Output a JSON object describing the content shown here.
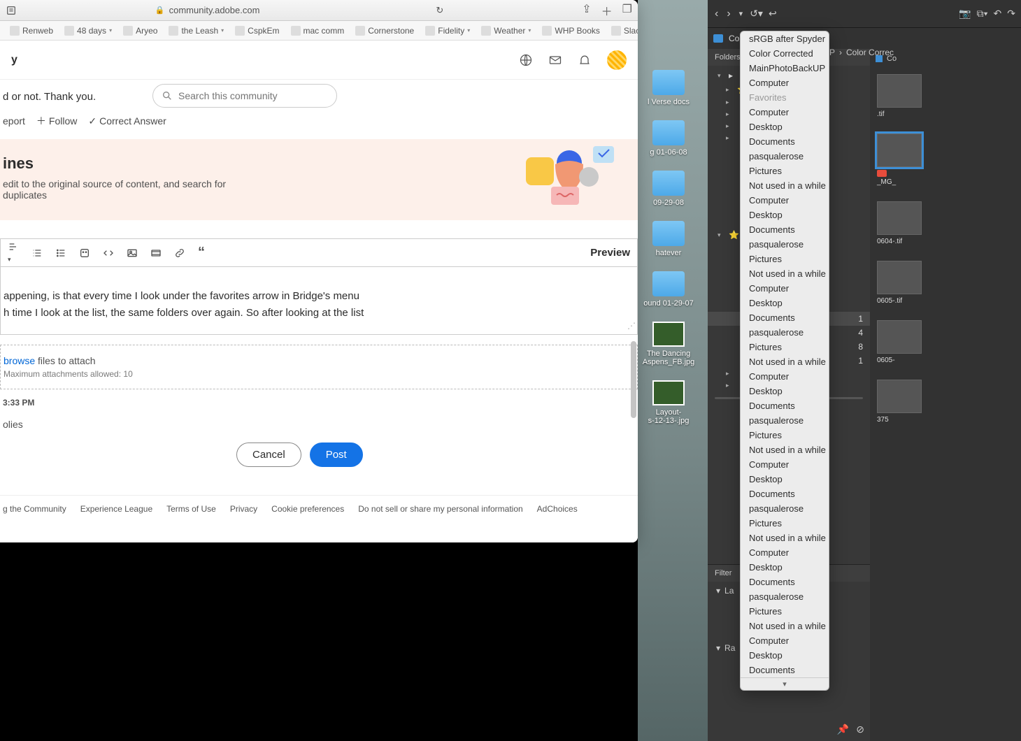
{
  "safari": {
    "url_host": "community.adobe.com",
    "bookmarks": [
      {
        "label": "Renweb",
        "caret": false
      },
      {
        "label": "48 days",
        "caret": true
      },
      {
        "label": "Aryeo",
        "caret": false
      },
      {
        "label": "the Leash",
        "caret": true
      },
      {
        "label": "CspkEm",
        "caret": false
      },
      {
        "label": "mac comm",
        "caret": false
      },
      {
        "label": "Cornerstone",
        "caret": false
      },
      {
        "label": "Fidelity",
        "caret": true
      },
      {
        "label": "Weather",
        "caret": true
      },
      {
        "label": "WHP Books",
        "caret": false
      },
      {
        "label": "Slack",
        "caret": false
      }
    ]
  },
  "community": {
    "title_fragment": "y",
    "search_placeholder": "Search this community",
    "line1": "d or not. Thank you.",
    "actions": {
      "report": "eport",
      "follow": "Follow",
      "correct": "Correct Answer"
    },
    "banner": {
      "title": "ines",
      "sub": "edit to the original source of content, and search for duplicates"
    },
    "editor": {
      "preview": "Preview",
      "body_l1": "appening, is that every time I look under the favorites arrow in Bridge's menu",
      "body_l2": "h time I look at the list, the same folders over again. So after looking at the list"
    },
    "attach": {
      "browse": "browse",
      "rest": " files to attach",
      "sub": "Maximum attachments allowed: 10"
    },
    "timestamp": "3:33 PM",
    "replies": "olies",
    "buttons": {
      "cancel": "Cancel",
      "post": "Post"
    },
    "footer": [
      "g the Community",
      "Experience League",
      "Terms of Use",
      "Privacy",
      "Cookie preferences",
      "Do not sell or share my personal information",
      "AdChoices"
    ]
  },
  "desktop": {
    "items": [
      {
        "type": "folder",
        "label": "l Verse docs"
      },
      {
        "type": "folder",
        "label": "g 01-06-08"
      },
      {
        "type": "folder",
        "label": "09-29-08"
      },
      {
        "type": "folder",
        "label": "hatever"
      },
      {
        "type": "folder",
        "label": "ound 01-29-07"
      },
      {
        "type": "image",
        "label": "The Dancing Aspens_FB.jpg"
      },
      {
        "type": "image",
        "label": "Layout-\ns-12-13-.jpg"
      }
    ]
  },
  "bridge": {
    "path": [
      "Com",
      "JP",
      "Color Correc"
    ],
    "folders_label": "Folders",
    "filter_label": "Filter",
    "filter_rows": [
      "La",
      "Ra"
    ],
    "right_path": "Co",
    "right_items": [
      {
        "label": ".tif",
        "selected": false
      },
      {
        "label": "_MG_",
        "selected": true,
        "rating": true
      },
      {
        "label": "0604-.tif",
        "selected": false
      },
      {
        "label": "0605-.tif",
        "selected": false
      },
      {
        "label": "0605-",
        "selected": false
      },
      {
        "label": "375",
        "selected": false
      }
    ],
    "tree_counts": [
      "1",
      "4",
      "8",
      "1"
    ],
    "favorites_menu": [
      "sRGB after Spyder",
      "Color Corrected",
      "MainPhotoBackUP",
      "Computer",
      "__sep__",
      "Computer",
      "Desktop",
      "Documents",
      "pasqualerose",
      "Pictures",
      "Not used in a while",
      "Computer",
      "Desktop",
      "Documents",
      "pasqualerose",
      "Pictures",
      "Not used in a while",
      "Computer",
      "Desktop",
      "Documents",
      "pasqualerose",
      "Pictures",
      "Not used in a while",
      "Computer",
      "Desktop",
      "Documents",
      "pasqualerose",
      "Pictures",
      "Not used in a while",
      "Computer",
      "Desktop",
      "Documents",
      "pasqualerose",
      "Pictures",
      "Not used in a while",
      "Computer",
      "Desktop",
      "Documents",
      "pasqualerose",
      "Pictures",
      "Not used in a while",
      "Computer",
      "Desktop",
      "Documents"
    ],
    "favorites_header": "Favorites"
  }
}
